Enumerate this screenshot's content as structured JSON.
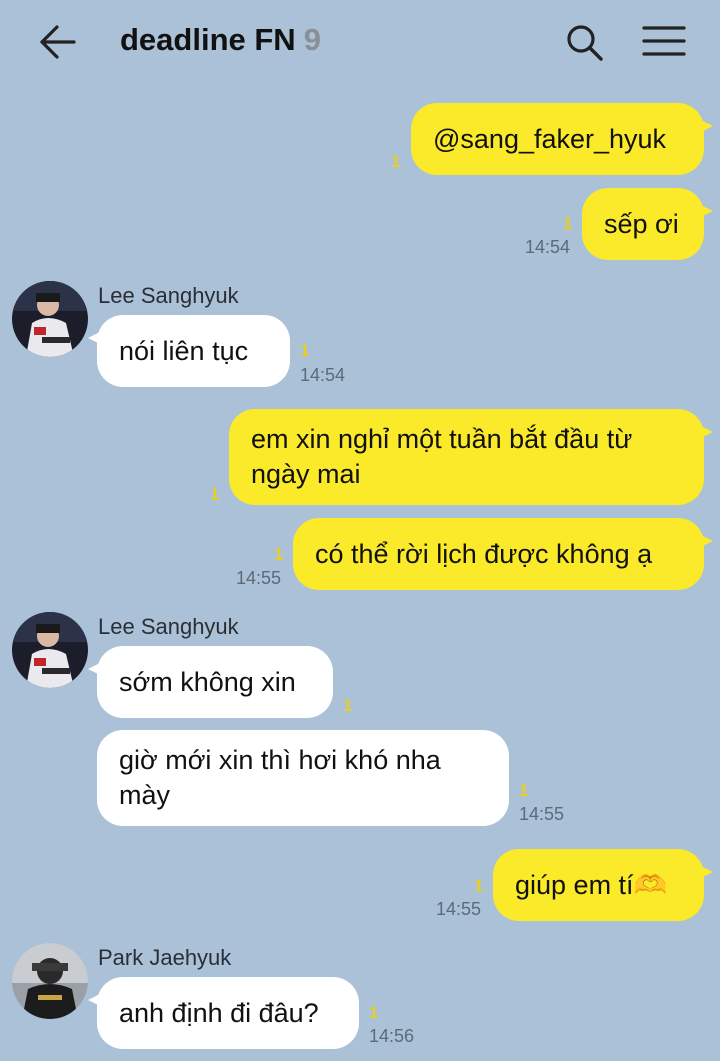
{
  "header": {
    "title": "deadline FN",
    "member_count": "9",
    "back_icon": "arrow-left-icon",
    "search_icon": "search-icon",
    "menu_icon": "hamburger-menu-icon"
  },
  "messages": [
    {
      "sender": "me",
      "text": "@sang_faker_hyuk",
      "unread": "1",
      "time": ""
    },
    {
      "sender": "me",
      "text": "sếp ơi",
      "unread": "1",
      "time": "14:54"
    },
    {
      "sender": "Lee Sanghyuk",
      "text": "nói liên tục",
      "unread": "1",
      "time": "14:54"
    },
    {
      "sender": "me",
      "text": "em xin nghỉ một tuần bắt đầu từ ngày mai",
      "unread": "1",
      "time": ""
    },
    {
      "sender": "me",
      "text": "có thể rời lịch được không ạ",
      "unread": "1",
      "time": "14:55"
    },
    {
      "sender": "Lee Sanghyuk",
      "text": "sớm không xin",
      "unread": "1",
      "time": ""
    },
    {
      "sender": "Lee Sanghyuk",
      "text": "giờ mới xin thì hơi khó nha mày",
      "unread": "1",
      "time": "14:55"
    },
    {
      "sender": "me",
      "text": "giúp em tí🫶",
      "unread": "1",
      "time": "14:55"
    },
    {
      "sender": "Park Jaehyuk",
      "text": "anh định đi đâu?",
      "unread": "1",
      "time": "14:56"
    }
  ],
  "senders": {
    "lee": "Lee Sanghyuk",
    "park": "Park Jaehyuk"
  },
  "colors": {
    "background": "#abc1d8",
    "my_bubble": "#fbea2a",
    "their_bubble": "#ffffff",
    "unread": "#e6cf1e"
  }
}
